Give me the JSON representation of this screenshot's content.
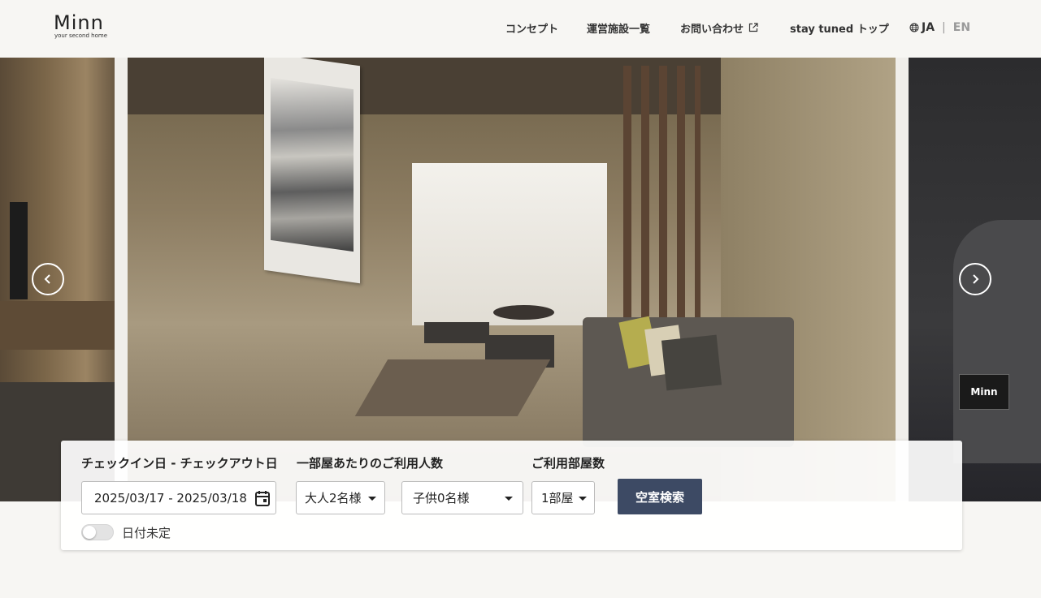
{
  "brand": {
    "logo_text": "Minn",
    "tagline": "your second home"
  },
  "nav": {
    "concept": "コンセプト",
    "facilities": "運営施設一覧",
    "contact": "お問い合わせ",
    "top": "stay tuned トップ"
  },
  "language": {
    "current": "JA",
    "separator": "|",
    "alternate": "EN"
  },
  "search": {
    "date_label": "チェックイン日 - チェックアウト日",
    "guests_label": "一部屋あたりのご利用人数",
    "rooms_label": "ご利用部屋数",
    "date_value": "2025/03/17 - 2025/03/18",
    "adults_value": "大人2名様",
    "children_value": "子供0名様",
    "rooms_value": "1部屋",
    "search_button": "空室検索",
    "undecided_label": "日付未定"
  },
  "colors": {
    "background": "#f7f6f3",
    "button": "#3d4a64",
    "text": "#333333"
  },
  "icons": [
    "globe-icon",
    "external-link-icon",
    "chevron-left-icon",
    "chevron-right-icon",
    "calendar-icon",
    "caret-down-icon"
  ]
}
